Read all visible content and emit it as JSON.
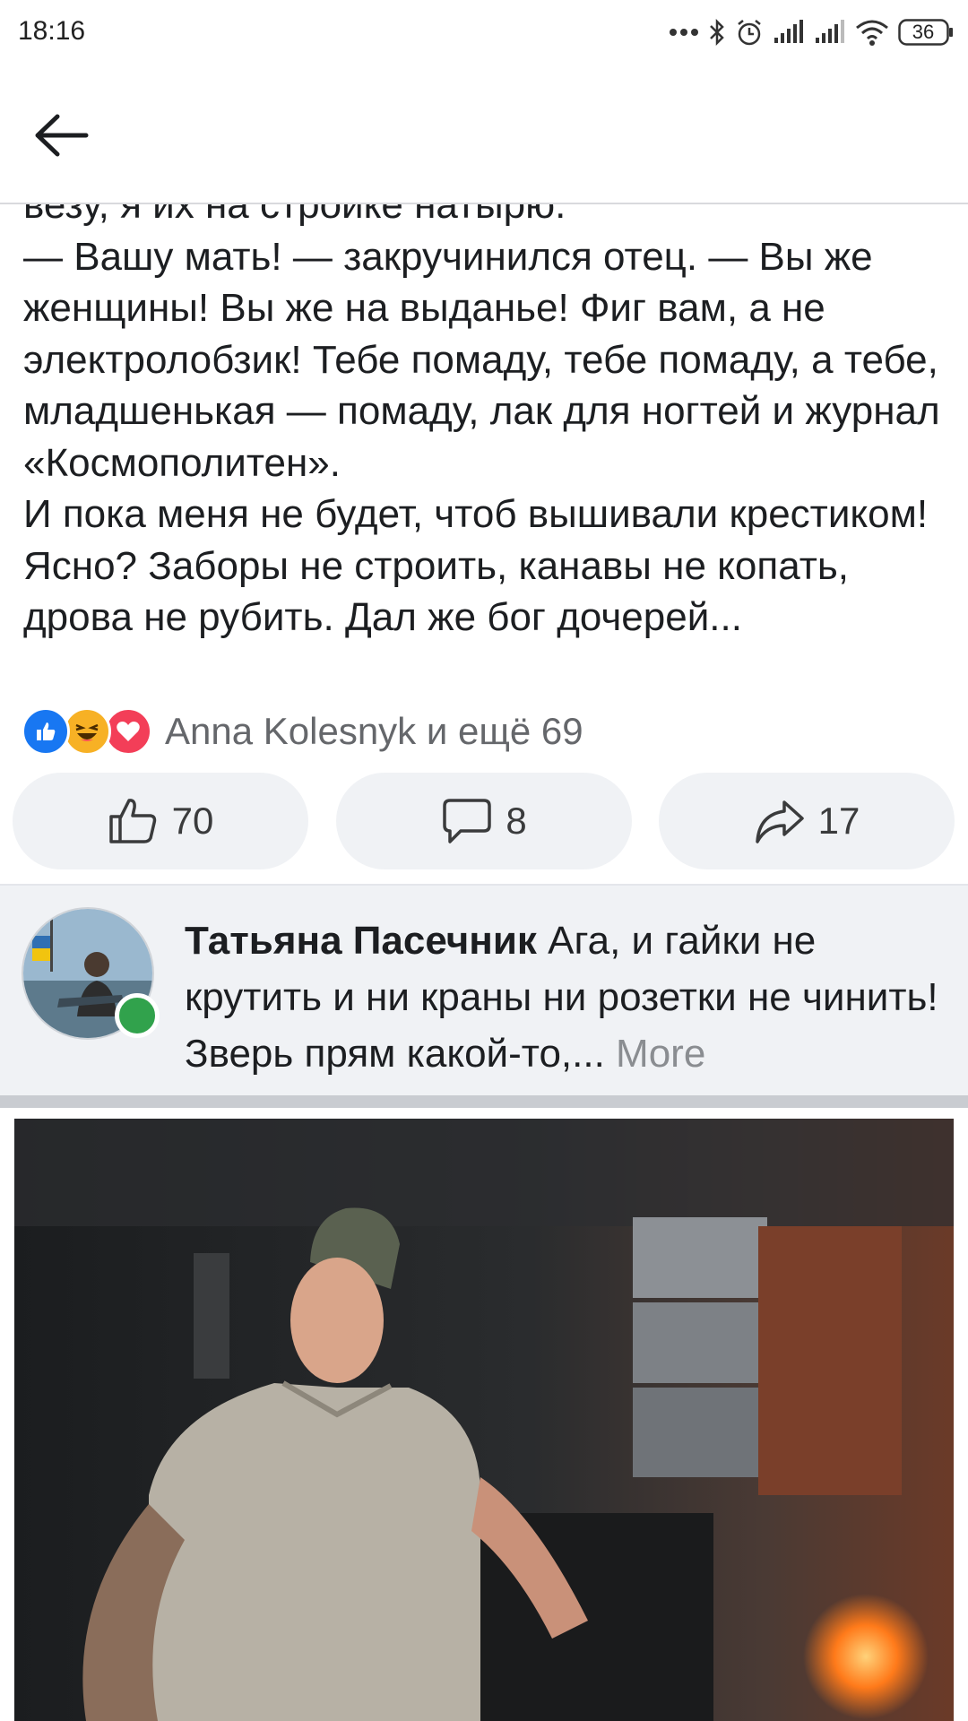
{
  "status_bar": {
    "time": "18:16",
    "battery": "36",
    "icons": [
      "more-dots-icon",
      "bluetooth-icon",
      "alarm-icon",
      "signal-icon",
      "signal-icon",
      "wifi-icon",
      "battery-icon"
    ]
  },
  "header": {
    "back_icon": "back-arrow-icon"
  },
  "post": {
    "clipped_line": "везу, я их на стройке натырю.",
    "paragraphs": [
      "— Вашу мать! — закручинился отец. — Вы же женщины! Вы же на выданье! Фиг вам, а не электролобзик! Тебе помаду, тебе помаду, а тебе, младшенькая — помаду, лак для ногтей и журнал «Космополитен».",
      "И пока меня не будет, чтоб вышивали крестиком! Ясно? Заборы не строить, канавы не копать, дрова не рубить. Дал же бог дочерей..."
    ]
  },
  "reactions": {
    "icons": [
      "like-reaction-icon",
      "haha-reaction-icon",
      "love-reaction-icon"
    ],
    "summary": "Anna Kolesnyk и ещё 69",
    "colors": {
      "like": "#1877f2",
      "haha": "#f7b125",
      "love": "#f33e58"
    }
  },
  "actions": {
    "like_count": "70",
    "comment_count": "8",
    "share_count": "17"
  },
  "comment": {
    "author": "Татьяна Пасечник",
    "text": "Ага, и гайки не крутить и ни краны ни розетки не чинить!  Зверь прям какой-то,...",
    "more_label": "More",
    "online": true
  },
  "photo": {
    "description_icon": "photo-image"
  },
  "colors": {
    "background": "#ffffff",
    "action_bg": "#f0f2f5",
    "secondary_text": "#65676b",
    "online_green": "#31a24c"
  }
}
